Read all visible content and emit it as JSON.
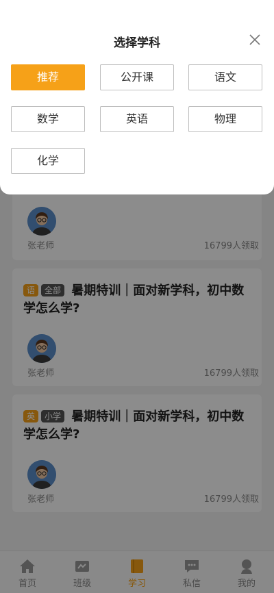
{
  "sheet": {
    "title": "选择学科",
    "subjects": [
      "推荐",
      "公开课",
      "语文",
      "数学",
      "英语",
      "物理",
      "化学"
    ],
    "selected": "推荐"
  },
  "cards": [
    {
      "teacher": "张老师",
      "count": "16799人领取"
    },
    {
      "subject_badge": "语",
      "level_badge": "全部",
      "title": "暑期特训｜面对新学科，初中数学怎么学?",
      "teacher": "张老师",
      "count": "16799人领取"
    },
    {
      "subject_badge": "英",
      "level_badge": "小学",
      "title": "暑期特训｜面对新学科，初中数学怎么学?",
      "teacher": "张老师",
      "count": "16799人领取"
    }
  ],
  "tabbar": {
    "items": [
      {
        "label": "首页",
        "icon": "home-icon"
      },
      {
        "label": "班级",
        "icon": "class-icon"
      },
      {
        "label": "学习",
        "icon": "book-icon"
      },
      {
        "label": "私信",
        "icon": "message-icon"
      },
      {
        "label": "我的",
        "icon": "profile-icon"
      }
    ],
    "active": "学习"
  },
  "colors": {
    "accent": "#f6a118",
    "level_badge": "#555555"
  }
}
